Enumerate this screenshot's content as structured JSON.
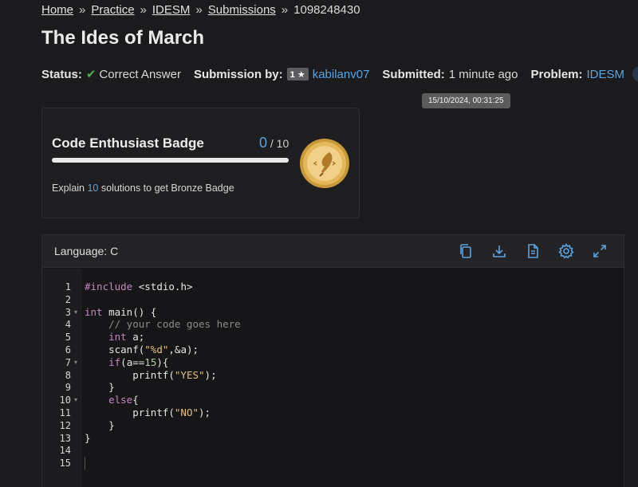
{
  "breadcrumb": [
    {
      "label": "Home",
      "link": true
    },
    {
      "label": "Practice",
      "link": true
    },
    {
      "label": "IDESM",
      "link": true
    },
    {
      "label": "Submissions",
      "link": true
    },
    {
      "label": "1098248430",
      "link": false
    }
  ],
  "breadcrumb_separator": "»",
  "page_title": "The Ides of March",
  "meta": {
    "status_label": "Status:",
    "status_value": "Correct Answer",
    "submission_by_label": "Submission by:",
    "user_rating": "1 ★",
    "username": "kabilanv07",
    "submitted_label": "Submitted:",
    "submitted_value": "1 minute ago",
    "problem_label": "Problem:",
    "problem_value": "IDESM",
    "truncated_next": "C"
  },
  "tooltip": "15/10/2024, 00:31:25",
  "badge": {
    "title": "Code Enthusiast Badge",
    "count": "0",
    "total": " / 10",
    "progress": 0,
    "desc_prefix": "Explain ",
    "desc_number": "10",
    "desc_suffix": " solutions to get Bronze Badge"
  },
  "code_panel": {
    "language_label": "Language: C",
    "tools": [
      "copy-icon",
      "download-icon",
      "document-icon",
      "settings-gear-icon",
      "fullscreen-icon"
    ]
  },
  "code_lines": [
    {
      "n": "1",
      "text": "#include <stdio.h>"
    },
    {
      "n": "2",
      "text": ""
    },
    {
      "n": "3",
      "text": "int main() {"
    },
    {
      "n": "4",
      "text": "    // your code goes here"
    },
    {
      "n": "5",
      "text": "    int a;"
    },
    {
      "n": "6",
      "text": "    scanf(\"%d\",&a);"
    },
    {
      "n": "7",
      "text": "    if(a==15){"
    },
    {
      "n": "8",
      "text": "        printf(\"YES\");"
    },
    {
      "n": "9",
      "text": "    }"
    },
    {
      "n": "10",
      "text": "    else{"
    },
    {
      "n": "11",
      "text": "        printf(\"NO\");"
    },
    {
      "n": "12",
      "text": "    }"
    },
    {
      "n": "13",
      "text": "}"
    },
    {
      "n": "14",
      "text": ""
    },
    {
      "n": "15",
      "text": ""
    }
  ],
  "colors": {
    "accent": "#5ba3e0",
    "success": "#4caf50",
    "keyword": "#c586c0",
    "string": "#e5c07b",
    "number": "#b5cea8",
    "comment": "#8b8b8b",
    "plain": "#e6e6e6"
  }
}
